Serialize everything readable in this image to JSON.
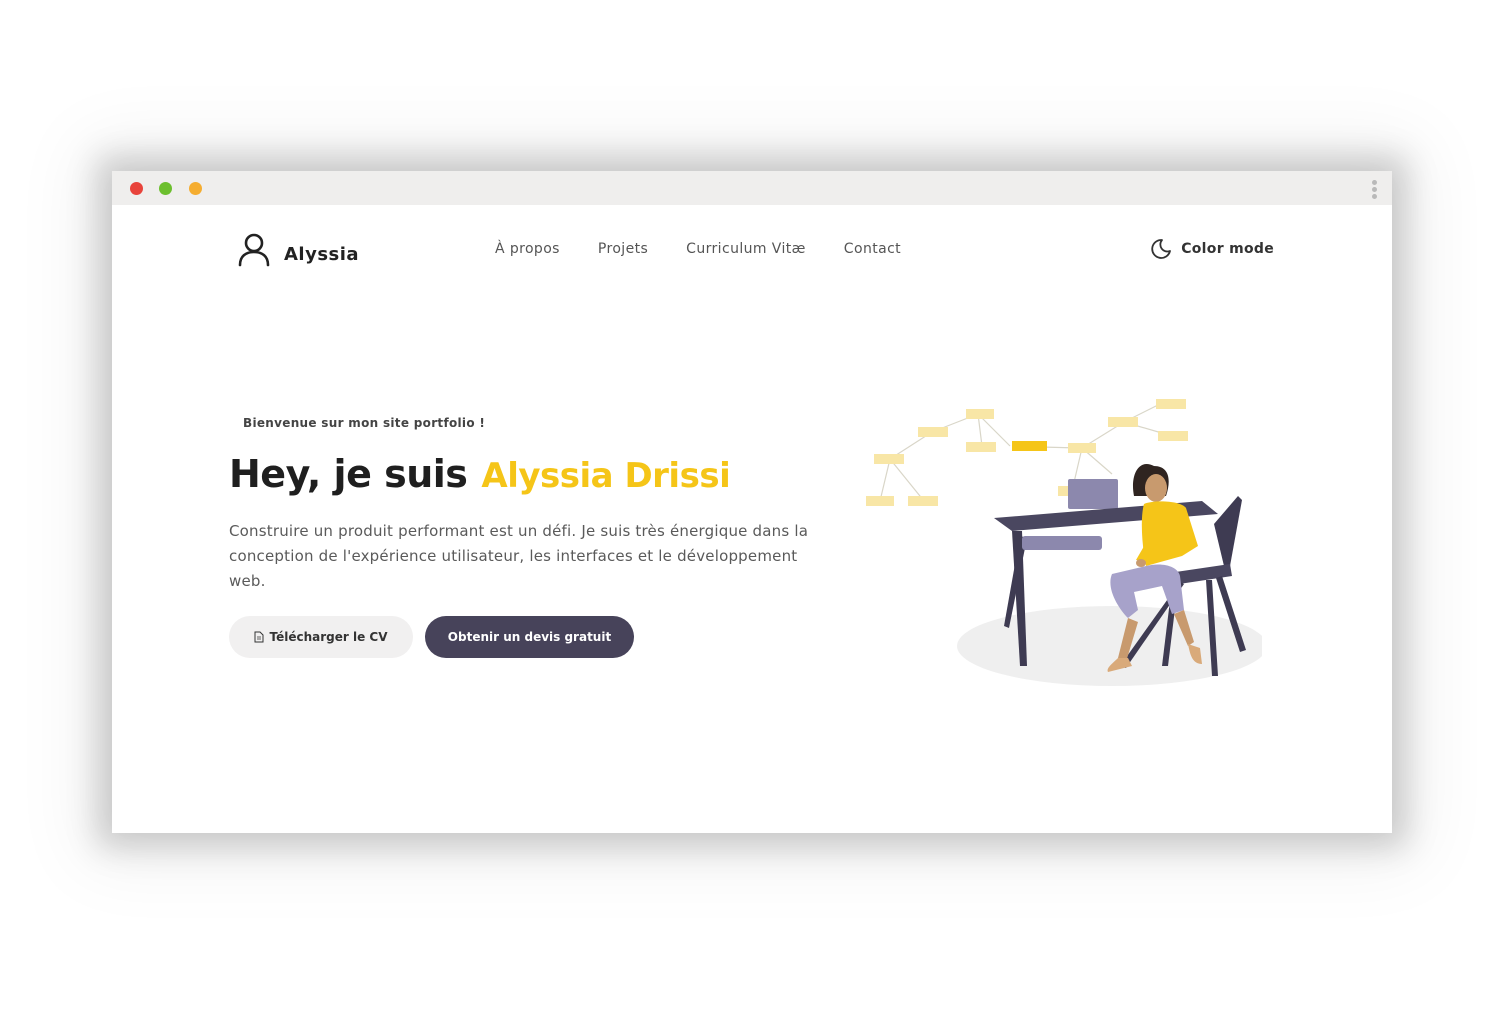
{
  "window": {
    "controls": [
      "close",
      "minimize",
      "maximize"
    ]
  },
  "nav": {
    "brand": {
      "name": "Alyssia",
      "icon": "user-icon"
    },
    "links": [
      {
        "label": "À propos"
      },
      {
        "label": "Projets"
      },
      {
        "label": "Curriculum Vitæ"
      },
      {
        "label": "Contact"
      }
    ],
    "color_mode": {
      "label": "Color mode",
      "icon": "moon-icon"
    }
  },
  "hero": {
    "welcome": "Bienvenue sur mon site portfolio !",
    "headline_prefix": "Hey, je suis",
    "headline_name": "Alyssia Drissi",
    "description": "Construire un produit performant est un défi. Je suis très énergique dans la conception de l'expérience utilisateur, les interfaces et le développement web.",
    "buttons": {
      "download_cv": "Télécharger le CV",
      "quote": "Obtenir un devis gratuit"
    }
  },
  "colors": {
    "accent": "#f5c518",
    "dark_button": "#47435a",
    "light_button": "#f1f0f0"
  }
}
